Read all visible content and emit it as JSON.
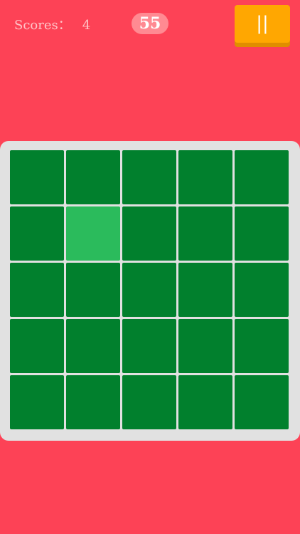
{
  "hud": {
    "score_label": "Scores：",
    "score_value": "4",
    "timer": "55",
    "pause_label": "||"
  },
  "board": {
    "rows": 5,
    "cols": 5,
    "odd_tile": [
      1,
      1
    ]
  },
  "colors": {
    "background": "#fd4256",
    "tile": "#01802d",
    "odd_tile": "#2bbb5c",
    "board_frame": "#e1e1e1",
    "pause_button": "#ffa701"
  }
}
